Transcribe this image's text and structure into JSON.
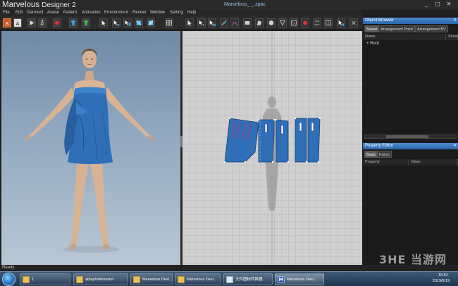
{
  "app": {
    "name": "Marvelous",
    "name_version": "Designer 2",
    "window_title": "Marvelous_ _.zpac",
    "controls": {
      "minimize": "_",
      "maximize": "□",
      "close": "✕"
    }
  },
  "menu": {
    "items": [
      {
        "label": "File"
      },
      {
        "label": "Edit"
      },
      {
        "label": "Garment"
      },
      {
        "label": "Avatar"
      },
      {
        "label": "Pattern"
      },
      {
        "label": "Animation"
      },
      {
        "label": "Environment"
      },
      {
        "label": "Render"
      },
      {
        "label": "Window"
      },
      {
        "label": "Setting"
      },
      {
        "label": "Help"
      }
    ]
  },
  "toolbar": {
    "left_tools": [
      "simulation-icon",
      "avatar-icon",
      "play-icon",
      "walk-icon",
      "record-icon",
      "garment-icon",
      "fit-icon",
      "select-icon",
      "move-icon",
      "fold-icon",
      "pin-icon",
      "texture-icon",
      "grid-icon"
    ],
    "right_tools": [
      "select-pattern-icon",
      "edit-pattern-icon",
      "transform-icon",
      "add-point-icon",
      "curve-icon",
      "rectangle-icon",
      "polygon-icon",
      "circle-icon",
      "dart-icon",
      "internal-line-icon",
      "sew-icon",
      "free-sew-icon",
      "fold-arrange-icon",
      "copy-icon",
      "settings-icon"
    ]
  },
  "status": {
    "text": "Ready"
  },
  "object_browser": {
    "title": "Object Browser",
    "tabs": [
      {
        "label": "Scene",
        "active": true
      },
      {
        "label": "Arrangement Point",
        "active": false
      },
      {
        "label": "Arrangement BV",
        "active": false
      }
    ],
    "columns": [
      "Name",
      "Show"
    ],
    "tree": [
      {
        "label": "Root",
        "expander": "+"
      }
    ]
  },
  "property_editor": {
    "title": "Property Editor",
    "tabs": [
      {
        "label": "Basic",
        "active": true
      },
      {
        "label": "Fabric",
        "active": false
      }
    ],
    "columns": [
      "Property",
      "Value"
    ]
  },
  "taskbar": {
    "items": [
      {
        "label": "1",
        "icon": "folder-icon"
      },
      {
        "label": "ablephotoresizer",
        "icon": "folder-icon"
      },
      {
        "label": "Marvelous Desi...",
        "icon": "folder-icon"
      },
      {
        "label": "Marvelous Desi...",
        "icon": "folder-icon"
      },
      {
        "label": "文件图标转换器...",
        "icon": "arrow-cursor-icon"
      },
      {
        "label": "Marvelous Desi...",
        "icon": "md-app-icon",
        "active": true
      }
    ],
    "time": "15:51",
    "date": "2019/6/19"
  },
  "watermark": "3HE 当游网",
  "colors": {
    "garment_blue": "#2f6fb7",
    "panel_title_blue": "#3a78c0",
    "viewport_sky": "#8fa6be",
    "grid_bg": "#d0d0d0"
  }
}
